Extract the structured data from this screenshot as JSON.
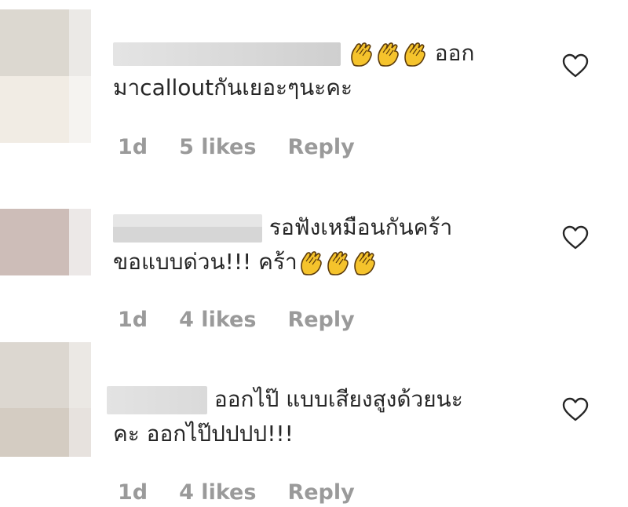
{
  "comments": [
    {
      "text_line1": " ออก",
      "text_line2": "มาcalloutกันเยอะๆนะคะ",
      "time": "1d",
      "likes": "5 likes",
      "reply": "Reply"
    },
    {
      "text_line1": " รอฟังเหมือนกันคร้า",
      "text_line2": "ขอแบบด่วน!!! คร้า",
      "time": "1d",
      "likes": "4 likes",
      "reply": "Reply"
    },
    {
      "text_line1": " ออกไป๊ แบบเสียงสูงด้วยนะ",
      "text_line2": "คะ ออกไป๊ปปปป!!!",
      "time": "1d",
      "likes": "4 likes",
      "reply": "Reply"
    }
  ],
  "icons": {
    "heart": "heart-outline-icon",
    "emoji": "clapping-hands-emoji"
  },
  "colors": {
    "text": "#262626",
    "meta": "#9a9a9a",
    "emoji_yellow": "#f5c32c"
  }
}
